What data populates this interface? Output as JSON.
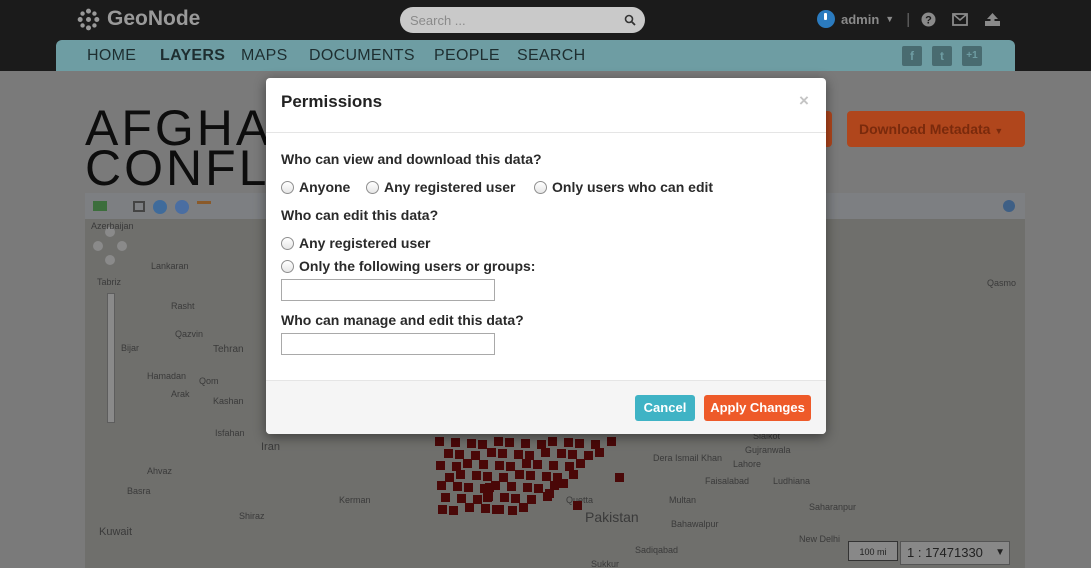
{
  "app": {
    "brand": "GeoNode",
    "search_placeholder": "Search ...",
    "user": "admin",
    "user_sep": "|"
  },
  "nav": {
    "items": [
      "HOME",
      "LAYERS",
      "MAPS",
      "DOCUMENTS",
      "PEOPLE",
      "SEARCH"
    ],
    "active": "LAYERS",
    "social": [
      "f",
      "t",
      "+1"
    ]
  },
  "page": {
    "title_line1": "AFGHA",
    "title_line2": "CONFL",
    "download_metadata_label": "Download Metadata"
  },
  "map": {
    "labels": [
      "Azerbaijan",
      "Lankaran",
      "Tabriz",
      "Rasht",
      "Tehran",
      "Hamadan",
      "Qom",
      "Arak",
      "Kashan",
      "Isfahan",
      "Iran",
      "Ahvaz",
      "Basra",
      "Kuwait",
      "Shiraz",
      "Kerman",
      "Bijar",
      "Qazvin",
      "Quetta",
      "Pakistan",
      "Multan",
      "Lahore",
      "Faisalabad",
      "Dera Ismail Khan",
      "Gujranwala",
      "Sialkot",
      "Ludhiana",
      "Bahawalpur",
      "Saharanpur",
      "Sadiqabad",
      "Sukkur",
      "Qasmo",
      "New Delhi"
    ],
    "scale_bar": "100 mi",
    "scale_ratio": "1 : 17471330"
  },
  "modal": {
    "title": "Permissions",
    "close": "×",
    "view_question": "Who can view and download this data?",
    "view_options": [
      "Anyone",
      "Any registered user",
      "Only users who can edit"
    ],
    "edit_question": "Who can edit this data?",
    "edit_options": [
      "Any registered user",
      "Only the following users or groups:"
    ],
    "edit_users_value": "",
    "manage_question": "Who can manage and edit this data?",
    "manage_users_value": "",
    "cancel_label": "Cancel",
    "apply_label": "Apply Changes"
  },
  "colors": {
    "topbar": "#1b1b1b",
    "nav": "#6e9da3",
    "cancel": "#3fb3c5",
    "apply": "#ee5a29",
    "overlay_marker": "#4a0808"
  }
}
